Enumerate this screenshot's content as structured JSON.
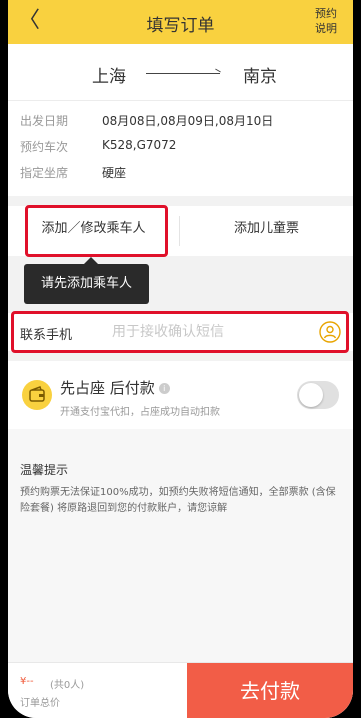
{
  "header": {
    "back_glyph": "〈",
    "title": "填写订单",
    "reserve_note": "预约说明"
  },
  "route": {
    "from": "上海",
    "to": "南京",
    "details": [
      {
        "label": "出发日期",
        "value": "08月08日,08月09日,08月10日"
      },
      {
        "label": "预约车次",
        "value": "K528,G7072"
      },
      {
        "label": "指定坐席",
        "value": "硬座"
      }
    ]
  },
  "passenger": {
    "add_passenger_label": "添加／修改乘车人",
    "add_child_ticket_label": "添加儿童票",
    "tooltip": "请先添加乘车人"
  },
  "contact": {
    "label": "联系手机",
    "placeholder": "用于接收确认短信",
    "icon": "contact-book-icon"
  },
  "payment_option": {
    "title": "先占座 后付款",
    "info_icon": "i",
    "subtitle": "开通支付宝代扣，占座成功自动扣款",
    "toggle_on": false
  },
  "tips": {
    "title": "温馨提示",
    "body": "预约购票无法保证100%成功，如预约失败将短信通知，全部票款 (含保险套餐) 将原路退回到您的付款账户，请您谅解"
  },
  "footer": {
    "price": "¥--",
    "count": "(共0人)",
    "total_label": "订单总价",
    "pay_button": "去付款"
  },
  "colors": {
    "header": "#f9d13f",
    "pay_button": "#f25d47",
    "highlight": "#e0102a",
    "price": "#f05a3a"
  }
}
